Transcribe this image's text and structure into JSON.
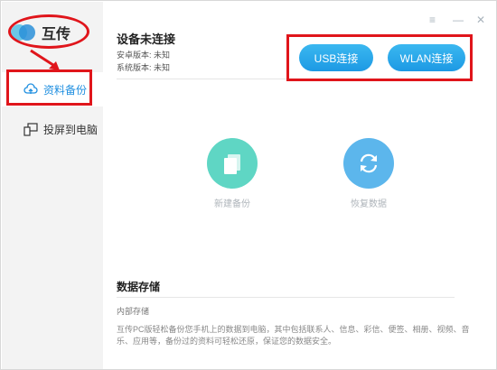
{
  "app": {
    "name": "互传"
  },
  "sidebar": {
    "items": [
      {
        "label": "资料备份",
        "icon": "cloud-upload-icon",
        "active": true
      },
      {
        "label": "投屏到电脑",
        "icon": "screen-mirror-icon",
        "active": false
      }
    ]
  },
  "window_controls": {
    "menu": "≡",
    "minimize": "—",
    "close": "✕"
  },
  "device": {
    "status": "设备未连接",
    "android_version": "安卓版本: 未知",
    "system_version": "系统版本: 未知"
  },
  "connect": {
    "usb_label": "USB连接",
    "wlan_label": "WLAN连接"
  },
  "actions": {
    "new_backup": "新建备份",
    "restore": "恢复数据"
  },
  "storage": {
    "title": "数据存储",
    "subtitle": "内部存储",
    "description": "互传PC版轻松备份您手机上的数据到电脑，其中包括联系人、信息、彩信、便签、相册、视频、音乐、应用等，备份过的资料可轻松还原，保证您的数据安全。"
  },
  "colors": {
    "accent": "#1d99e4",
    "annotation": "#e0151b",
    "new_backup_circle": "#5fd6c4",
    "restore_circle": "#5cb6ec"
  }
}
